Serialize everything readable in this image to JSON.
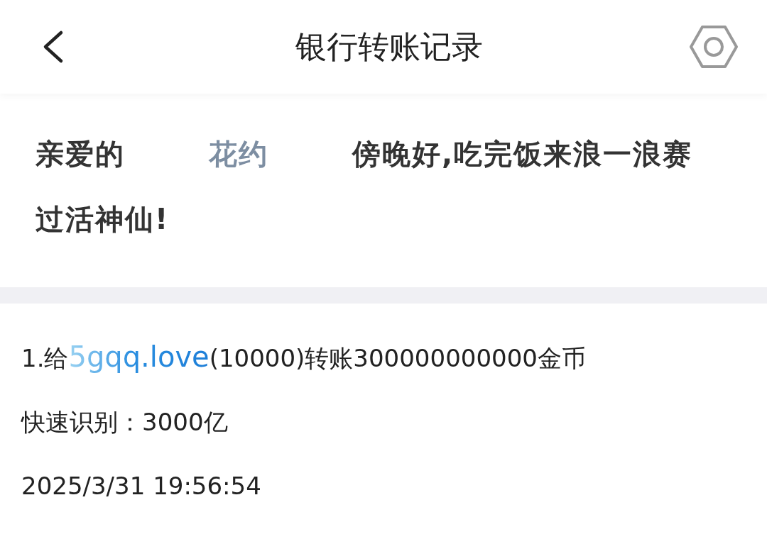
{
  "header": {
    "title": "银行转账记录"
  },
  "greeting": {
    "prefix": "亲爱的",
    "name": "花约",
    "suffix": "傍晚好,吃完饭来浪一浪赛过活神仙!"
  },
  "records": [
    {
      "index": "1.给",
      "user": "5gqq.love",
      "detail": "(10000)转账300000000000金币",
      "quick_label": "快速识别：",
      "quick_value": "3000亿",
      "time": "2025/3/31 19:56:54"
    }
  ]
}
